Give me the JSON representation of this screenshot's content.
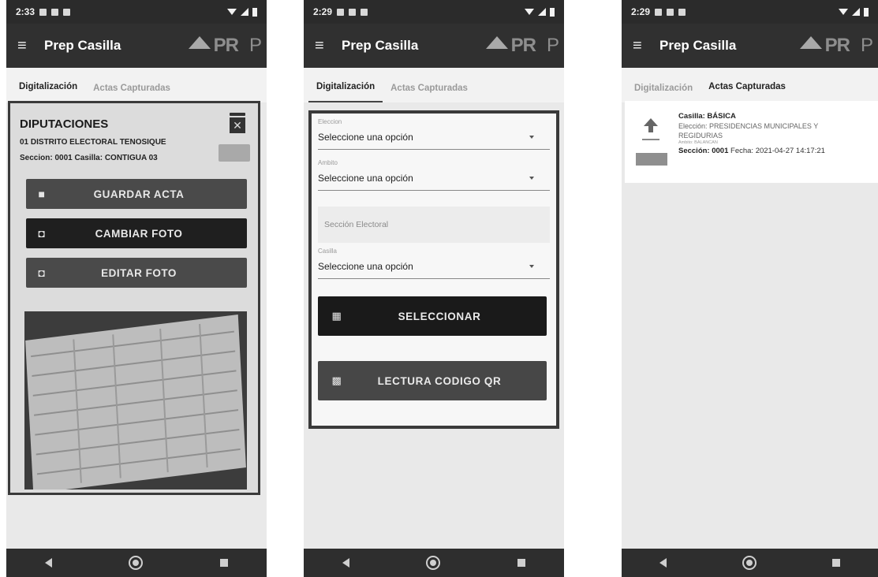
{
  "app": {
    "title": "Prep Casilla",
    "logo_pr": "PR",
    "logo_p": "P",
    "menu_icon": "hamburger-icon"
  },
  "tabs": {
    "digitalizacion": "Digitalización",
    "actas": "Actas Capturadas"
  },
  "phone1": {
    "time": "2:33",
    "card_title": "DIPUTACIONES",
    "district": "01 DISTRITO ELECTORAL TENOSIQUE",
    "section_line": "Seccion: 0001  Casilla: CONTIGUA 03",
    "buttons": [
      {
        "label": "GUARDAR ACTA",
        "icon": "save-icon",
        "color": "#4a4a4a"
      },
      {
        "label": "CAMBIAR FOTO",
        "icon": "camera-icon",
        "color": "#1f1f1f"
      },
      {
        "label": "EDITAR FOTO",
        "icon": "camera-icon",
        "color": "#4a4a4a"
      }
    ]
  },
  "phone2": {
    "time": "2:29",
    "fields": [
      {
        "label": "Eleccion",
        "value": "Seleccione una opción"
      },
      {
        "label": "Ambito",
        "value": "Seleccione una opción"
      },
      {
        "label": "Casilla",
        "value": "Seleccione una opción"
      }
    ],
    "seccion_placeholder": "Sección Electoral",
    "btn_select": "SELECCIONAR",
    "btn_qr": "LECTURA CODIGO QR"
  },
  "phone3": {
    "time": "2:29",
    "item": {
      "casilla": "Casilla: BÁSICA",
      "eleccion_1": "Elección: PRESIDENCIAS MUNICIPALES Y",
      "eleccion_2": "REGIDURIAS",
      "ambito": "Ambito: BALANCAN",
      "seccion_label": "Sección: 0001",
      "fecha": "Fecha: 2021-04-27 14:17:21"
    }
  }
}
